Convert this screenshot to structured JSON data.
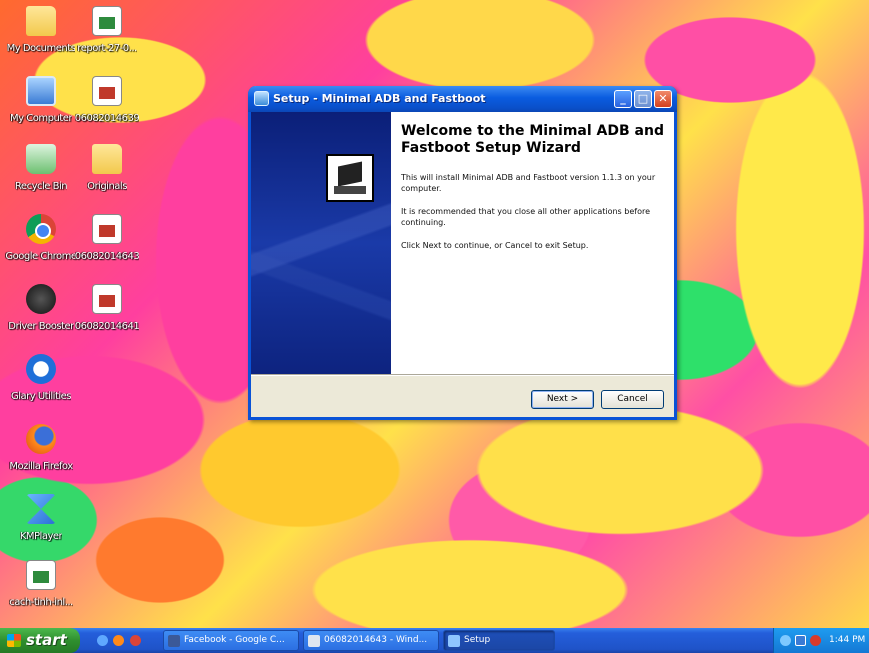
{
  "desktop": {
    "icons": [
      {
        "label": "My Documents",
        "icon": "folder-icon"
      },
      {
        "label": "report-27-0...",
        "icon": "excel-file-icon"
      },
      {
        "label": "My Computer",
        "icon": "computer-icon"
      },
      {
        "label": "06082014639",
        "icon": "document-icon"
      },
      {
        "label": "Recycle Bin",
        "icon": "recycle-bin-icon"
      },
      {
        "label": "Originals",
        "icon": "folder-icon"
      },
      {
        "label": "Google Chrome",
        "icon": "chrome-icon"
      },
      {
        "label": "06082014643",
        "icon": "document-icon"
      },
      {
        "label": "Driver Booster",
        "icon": "driver-booster-icon"
      },
      {
        "label": "06082014641",
        "icon": "document-icon"
      },
      {
        "label": "Glary Utilities",
        "icon": "glary-utilities-icon"
      },
      {
        "label": "Mozilla Firefox",
        "icon": "firefox-icon"
      },
      {
        "label": "KMPlayer",
        "icon": "kmplayer-icon"
      },
      {
        "label": "cach-tinh-inl...",
        "icon": "excel-file-icon"
      }
    ]
  },
  "dialog": {
    "title": "Setup - Minimal ADB and Fastboot",
    "heading": "Welcome to the Minimal ADB and Fastboot Setup Wizard",
    "paragraphs": [
      "This will install Minimal ADB and Fastboot version 1.1.3 on your computer.",
      "It is recommended that you close all other applications before continuing.",
      "Click Next to continue, or Cancel to exit Setup."
    ],
    "next_label": "Next >",
    "cancel_label": "Cancel",
    "minimize_glyph": "_",
    "maximize_glyph": "□",
    "close_glyph": "✕"
  },
  "taskbar": {
    "start_label": "start",
    "tasks": [
      {
        "label": "Facebook - Google C...",
        "icon": "chrome-icon"
      },
      {
        "label": "06082014643 - Wind...",
        "icon": "image-viewer-icon"
      },
      {
        "label": "Setup",
        "icon": "setup-icon"
      }
    ],
    "clock": "1:44 PM"
  },
  "colors": {
    "titlebar": "#0a5ce0",
    "taskbar": "#245edb",
    "start": "#2f8f2f",
    "wizard_panel": "#0b1f78"
  }
}
